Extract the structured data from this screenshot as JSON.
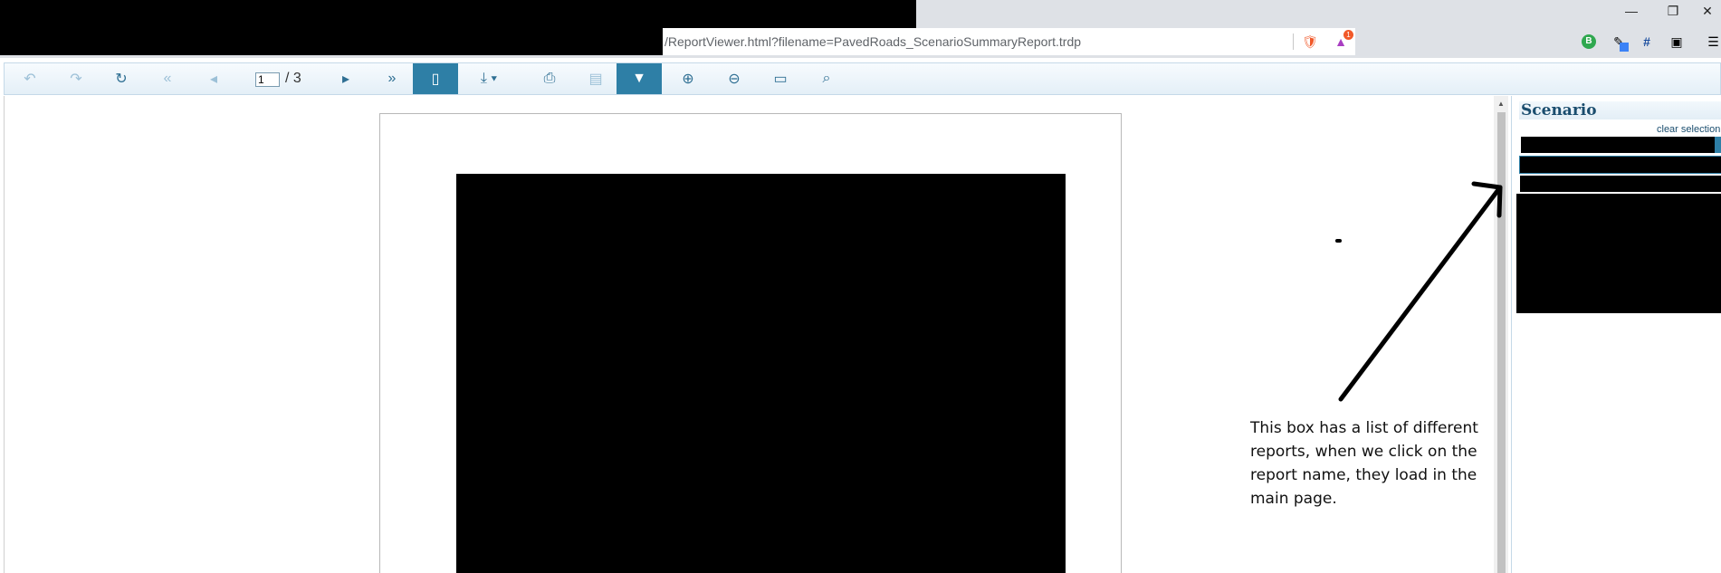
{
  "browser": {
    "address": "/ReportViewer.html?filename=PavedRoads_ScenarioSummaryReport.trdp",
    "window_controls": {
      "minimize": "—",
      "restore": "❐",
      "close": "✕"
    },
    "extensions": [
      {
        "icon": "brave-shield-icon",
        "glyph": "🛡",
        "color": "#f1592a"
      },
      {
        "icon": "rewards-triangle-icon",
        "glyph": "▲",
        "color": "#a93ec2",
        "badge": "1"
      },
      {
        "icon": "ext-green-b-icon",
        "glyph": "B",
        "color": "#2fa84f"
      },
      {
        "icon": "ext-pen-icon",
        "glyph": "✎",
        "color": "#333333"
      },
      {
        "icon": "ext-hash-icon",
        "glyph": "#",
        "color": "#1a4d9e"
      },
      {
        "icon": "ext-card-icon",
        "glyph": "▣",
        "color": "#333333"
      },
      {
        "icon": "menu-icon",
        "glyph": "☰",
        "color": "#333333"
      }
    ]
  },
  "toolbar": {
    "back_icon": "↶",
    "forward_icon": "↷",
    "refresh_icon": "↻",
    "first_page_icon": "«",
    "prev_page_icon": "◂",
    "current_page": "1",
    "total_pages": "/ 3",
    "next_page_icon": "▸",
    "last_page_icon": "»",
    "page_view_icon": "▯",
    "export_icon": "⤓ ▾",
    "print_icon": "⎙",
    "save_icon": "▤",
    "filter_icon": "▼",
    "zoom_in_icon": "⊕",
    "zoom_out_icon": "⊖",
    "fullscreen_icon": "▭",
    "search_icon": "⌕"
  },
  "panel": {
    "title": "Scenario",
    "clear_selection": "clear selection"
  },
  "annotation": {
    "note": "This box has a list of different reports, when we click on the report name, they load in the main page."
  },
  "colors": {
    "toolbar_active": "#2e7fa6",
    "panel_title": "#1a4d6e"
  }
}
